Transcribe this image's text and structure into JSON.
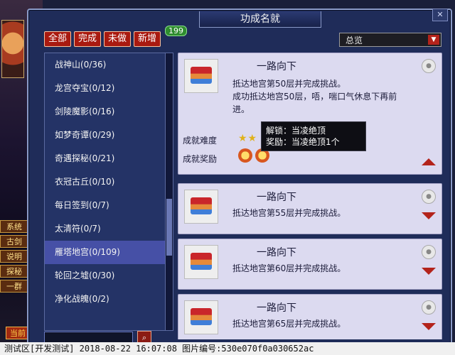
{
  "window": {
    "title": "功成名就",
    "close_label": "✕"
  },
  "filters": {
    "all": "全部",
    "done": "完成",
    "undone": "未做",
    "new": "新增",
    "new_count": "199"
  },
  "dropdown": {
    "selected": "总览"
  },
  "left_list": [
    {
      "label": "战神山(0/36)"
    },
    {
      "label": "龙宫夺宝(0/12)"
    },
    {
      "label": "剑陵魔影(0/16)"
    },
    {
      "label": "如梦奇谭(0/29)"
    },
    {
      "label": "奇遇探秘(0/21)"
    },
    {
      "label": "衣冠古丘(0/10)"
    },
    {
      "label": "每日签到(0/7)"
    },
    {
      "label": "太清符(0/7)"
    },
    {
      "label": "雁塔地宫(0/109)"
    },
    {
      "label": "轮回之墟(0/30)"
    },
    {
      "label": "净化战魄(0/2)"
    }
  ],
  "active_index": 8,
  "expanded_card": {
    "title": "一路向下",
    "desc1": "抵达地宫第50层并完成挑战。",
    "desc2": "成功抵达地宫50层，唔，喘口气休息下再前",
    "desc3": "进。",
    "difficulty_label": "成就难度",
    "reward_label": "成就奖励",
    "tooltip_line1": "解锁：当凌绝顶",
    "tooltip_line2": "奖励：当凌绝顶1个"
  },
  "cards": [
    {
      "title": "一路向下",
      "desc": "抵达地宫第55层并完成挑战。"
    },
    {
      "title": "一路向下",
      "desc": "抵达地宫第60层并完成挑战。"
    },
    {
      "title": "一路向下",
      "desc": "抵达地宫第65层并完成挑战。"
    }
  ],
  "game_ui": {
    "tab1": "系统",
    "tab2": "古剑",
    "tab3": "说明",
    "tab4": "探秘",
    "bottom_btn": "当前",
    "side_text": "一群"
  },
  "status_bar": "测试区[开发测试] 2018-08-22 16:07:08 图片编号:530e070f0a030652ac"
}
